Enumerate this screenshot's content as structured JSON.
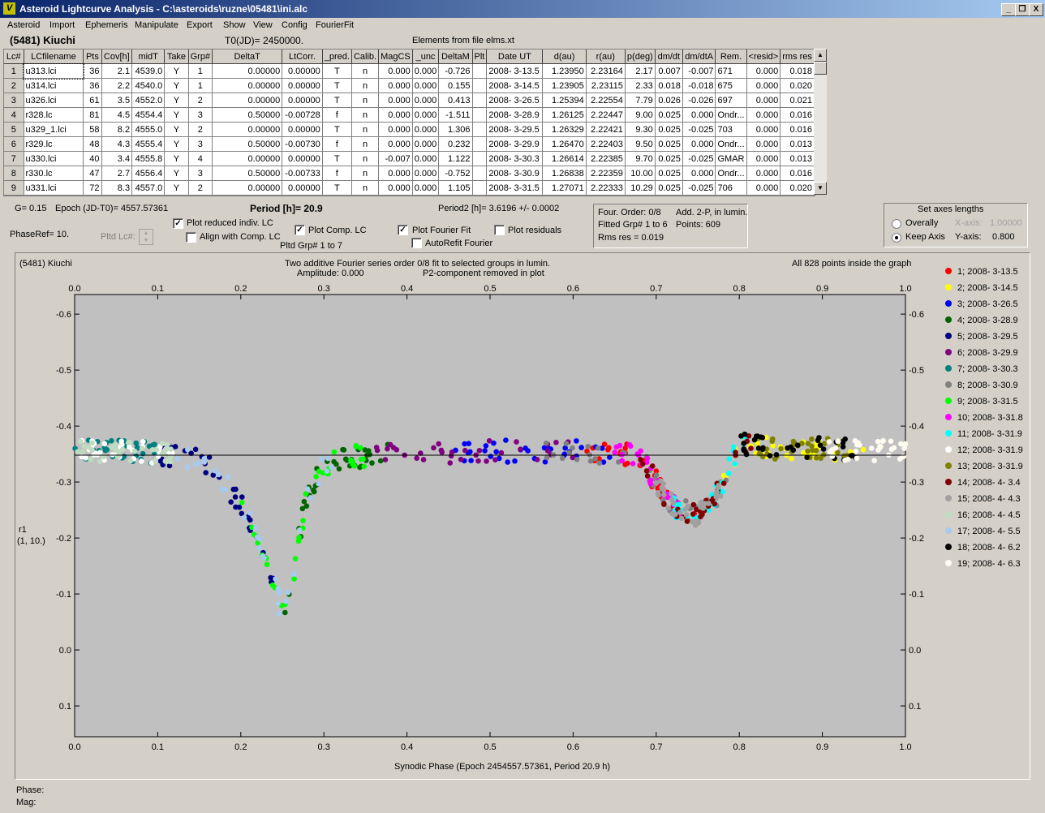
{
  "window": {
    "title": "Asteroid Lightcurve Analysis - C:\\asteroids\\ruzne\\05481\\ini.alc",
    "app_icon": "V",
    "buttons": {
      "minimize": "_",
      "restore": "❐",
      "close": "X"
    }
  },
  "menu": [
    "Asteroid",
    "Import",
    "Ephemeris",
    "Manipulate",
    "Export",
    "Show",
    "View",
    "Config",
    "FourierFit"
  ],
  "header": {
    "asteroid": "(5481) Kiuchi",
    "t0": "T0(JD)= 2450000.",
    "elements": "Elements from file elms.xt"
  },
  "table": {
    "columns": [
      "Lc#",
      "LCfilename",
      "Pts",
      "Cov[h]",
      "midT",
      "Take",
      "Grp#",
      "DeltaT",
      "LtCorr.",
      "_pred.",
      "Calib.",
      "MagCS",
      "_unc",
      "DeltaM",
      "Plt",
      "Date UT",
      "d(au)",
      "r(au)",
      "p(deg)",
      "dm/dt",
      "dm/dtA",
      "Rem.",
      "<resid>",
      "rms res"
    ],
    "rows": [
      [
        "1",
        "u313.lci",
        "36",
        "2.1",
        "4539.0",
        "Y",
        "1",
        "0.00000",
        "0.00000",
        "T",
        "n",
        "0.000",
        "0.000",
        "-0.726",
        "",
        "2008- 3-13.5",
        "1.23950",
        "2.23164",
        "2.17",
        "0.007",
        "-0.007",
        "671",
        "0.000",
        "0.018"
      ],
      [
        "2",
        "u314.lci",
        "36",
        "2.2",
        "4540.0",
        "Y",
        "1",
        "0.00000",
        "0.00000",
        "T",
        "n",
        "0.000",
        "0.000",
        "0.155",
        "",
        "2008- 3-14.5",
        "1.23905",
        "2.23115",
        "2.33",
        "0.018",
        "-0.018",
        "675",
        "0.000",
        "0.020"
      ],
      [
        "3",
        "u326.lci",
        "61",
        "3.5",
        "4552.0",
        "Y",
        "2",
        "0.00000",
        "0.00000",
        "T",
        "n",
        "0.000",
        "0.000",
        "0.413",
        "",
        "2008- 3-26.5",
        "1.25394",
        "2.22554",
        "7.79",
        "0.026",
        "-0.026",
        "697",
        "0.000",
        "0.021"
      ],
      [
        "4",
        "r328.lc",
        "81",
        "4.5",
        "4554.4",
        "Y",
        "3",
        "0.50000",
        "-0.00728",
        "f",
        "n",
        "0.000",
        "0.000",
        "-1.511",
        "",
        "2008- 3-28.9",
        "1.26125",
        "2.22447",
        "9.00",
        "0.025",
        "0.000",
        "Ondr...",
        "0.000",
        "0.016"
      ],
      [
        "5",
        "u329_1.lci",
        "58",
        "8.2",
        "4555.0",
        "Y",
        "2",
        "0.00000",
        "0.00000",
        "T",
        "n",
        "0.000",
        "0.000",
        "1.306",
        "",
        "2008- 3-29.5",
        "1.26329",
        "2.22421",
        "9.30",
        "0.025",
        "-0.025",
        "703",
        "0.000",
        "0.016"
      ],
      [
        "6",
        "r329.lc",
        "48",
        "4.3",
        "4555.4",
        "Y",
        "3",
        "0.50000",
        "-0.00730",
        "f",
        "n",
        "0.000",
        "0.000",
        "0.232",
        "",
        "2008- 3-29.9",
        "1.26470",
        "2.22403",
        "9.50",
        "0.025",
        "0.000",
        "Ondr...",
        "0.000",
        "0.013"
      ],
      [
        "7",
        "u330.lci",
        "40",
        "3.4",
        "4555.8",
        "Y",
        "4",
        "0.00000",
        "0.00000",
        "T",
        "n",
        "-0.007",
        "0.000",
        "1.122",
        "",
        "2008- 3-30.3",
        "1.26614",
        "2.22385",
        "9.70",
        "0.025",
        "-0.025",
        "GMAR",
        "0.000",
        "0.013"
      ],
      [
        "8",
        "r330.lc",
        "47",
        "2.7",
        "4556.4",
        "Y",
        "3",
        "0.50000",
        "-0.00733",
        "f",
        "n",
        "0.000",
        "0.000",
        "-0.752",
        "",
        "2008- 3-30.9",
        "1.26838",
        "2.22359",
        "10.00",
        "0.025",
        "0.000",
        "Ondr...",
        "0.000",
        "0.016"
      ],
      [
        "9",
        "u331.lci",
        "72",
        "8.3",
        "4557.0",
        "Y",
        "2",
        "0.00000",
        "0.00000",
        "T",
        "n",
        "0.000",
        "0.000",
        "1.105",
        "",
        "2008- 3-31.5",
        "1.27071",
        "2.22333",
        "10.29",
        "0.025",
        "-0.025",
        "706",
        "0.000",
        "0.020"
      ]
    ]
  },
  "info": {
    "g": "G= 0.15",
    "epoch": "Epoch (JD-T0)= 4557.57361",
    "period": "Period [h]= 20.9",
    "period2": "Period2 [h]= 3.6196 +/- 0.0002",
    "phaseref": "PhaseRef= 10.",
    "pltd_lc": "Pltd Lc#:",
    "pltd_grp": "Pltd Grp#  1   to   7"
  },
  "checkboxes": [
    {
      "label": "Plot reduced indiv. LC",
      "checked": true
    },
    {
      "label": "Align with Comp. LC",
      "checked": false
    },
    {
      "label": "Plot Comp. LC",
      "checked": true
    },
    {
      "label": "Plot Fourier Fit",
      "checked": true
    },
    {
      "label": "AutoRefit Fourier",
      "checked": false
    },
    {
      "label": "Plot residuals",
      "checked": false
    }
  ],
  "fourier_box": {
    "order": "Four. Order:  0/8",
    "add": "Add. 2-P, in lumin.",
    "fitted": "Fitted Grp# 1 to 6",
    "points": "Points: 609",
    "rms": "Rms res     = 0.019"
  },
  "axes_box": {
    "title": "Set axes lengths",
    "overally": "Overally",
    "keep_axis": "Keep Axis",
    "selected": "keep_axis",
    "xaxis_label": "X-axis:",
    "xaxis_value": "1.00000",
    "yaxis_label": "Y-axis:",
    "yaxis_value": "0.800"
  },
  "plot": {
    "name": "(5481) Kiuchi",
    "line1": "Two additive Fourier series order 0/8 fit to selected groups in lumin.",
    "line2_left": "Amplitude: 0.000",
    "line2_right": "P2-component removed in plot",
    "points_note": "All 828 points inside the graph",
    "ylabel1": "r1",
    "ylabel2": "(1, 10.)",
    "xlabel": "Synodic Phase (Epoch 2454557.57361, Period 20.9 h)"
  },
  "chart_data": {
    "type": "scatter",
    "x_ticks": [
      "0.0",
      "0.1",
      "0.2",
      "0.3",
      "0.4",
      "0.5",
      "0.6",
      "0.7",
      "0.8",
      "0.9",
      "1.0"
    ],
    "y_ticks": [
      "-0.6",
      "-0.5",
      "-0.4",
      "-0.3",
      "-0.2",
      "-0.1",
      "0.0",
      "0.1"
    ],
    "xlim": [
      0,
      1
    ],
    "ylim": [
      -0.6,
      0.1
    ],
    "inverted_y": true,
    "fit_line_y": -0.348,
    "series": [
      {
        "name": "1; 2008- 3-13.5",
        "color": "#ff0000"
      },
      {
        "name": "2; 2008- 3-14.5",
        "color": "#ffff00"
      },
      {
        "name": "3; 2008- 3-26.5",
        "color": "#0000ff"
      },
      {
        "name": "4; 2008- 3-28.9",
        "color": "#006400"
      },
      {
        "name": "5; 2008- 3-29.5",
        "color": "#000080"
      },
      {
        "name": "6; 2008- 3-29.9",
        "color": "#800080"
      },
      {
        "name": "7; 2008- 3-30.3",
        "color": "#008080"
      },
      {
        "name": "8; 2008- 3-30.9",
        "color": "#808080"
      },
      {
        "name": "9; 2008- 3-31.5",
        "color": "#00ff00"
      },
      {
        "name": "10; 2008- 3-31.8",
        "color": "#ff00ff"
      },
      {
        "name": "11; 2008- 3-31.9",
        "color": "#00ffff"
      },
      {
        "name": "12; 2008- 3-31.9",
        "color": "#ffffff"
      },
      {
        "name": "13; 2008- 3-31.9",
        "color": "#808000"
      },
      {
        "name": "14; 2008- 4- 3.4",
        "color": "#800000"
      },
      {
        "name": "15; 2008- 4- 4.3",
        "color": "#a0a0a0"
      },
      {
        "name": "16; 2008- 4- 4.5",
        "color": "#c0dcc0"
      },
      {
        "name": "17; 2008- 4- 5.5",
        "color": "#a6caf0"
      },
      {
        "name": "18; 2008- 4- 6.2",
        "color": "#000000"
      },
      {
        "name": "19; 2008- 4- 6.3",
        "color": "#fffbf0"
      }
    ],
    "profile": [
      [
        0.0,
        -0.355
      ],
      [
        0.05,
        -0.355
      ],
      [
        0.1,
        -0.352
      ],
      [
        0.14,
        -0.342
      ],
      [
        0.16,
        -0.33
      ],
      [
        0.18,
        -0.3
      ],
      [
        0.2,
        -0.26
      ],
      [
        0.22,
        -0.2
      ],
      [
        0.24,
        -0.12
      ],
      [
        0.25,
        -0.06
      ],
      [
        0.26,
        -0.1
      ],
      [
        0.27,
        -0.2
      ],
      [
        0.28,
        -0.28
      ],
      [
        0.3,
        -0.33
      ],
      [
        0.33,
        -0.345
      ],
      [
        0.4,
        -0.35
      ],
      [
        0.5,
        -0.355
      ],
      [
        0.6,
        -0.355
      ],
      [
        0.65,
        -0.352
      ],
      [
        0.68,
        -0.345
      ],
      [
        0.7,
        -0.3
      ],
      [
        0.72,
        -0.255
      ],
      [
        0.75,
        -0.24
      ],
      [
        0.77,
        -0.27
      ],
      [
        0.79,
        -0.33
      ],
      [
        0.8,
        -0.37
      ],
      [
        0.83,
        -0.36
      ],
      [
        0.9,
        -0.36
      ],
      [
        1.0,
        -0.355
      ]
    ]
  },
  "status": {
    "phase": "Phase:",
    "mag": "Mag:"
  }
}
